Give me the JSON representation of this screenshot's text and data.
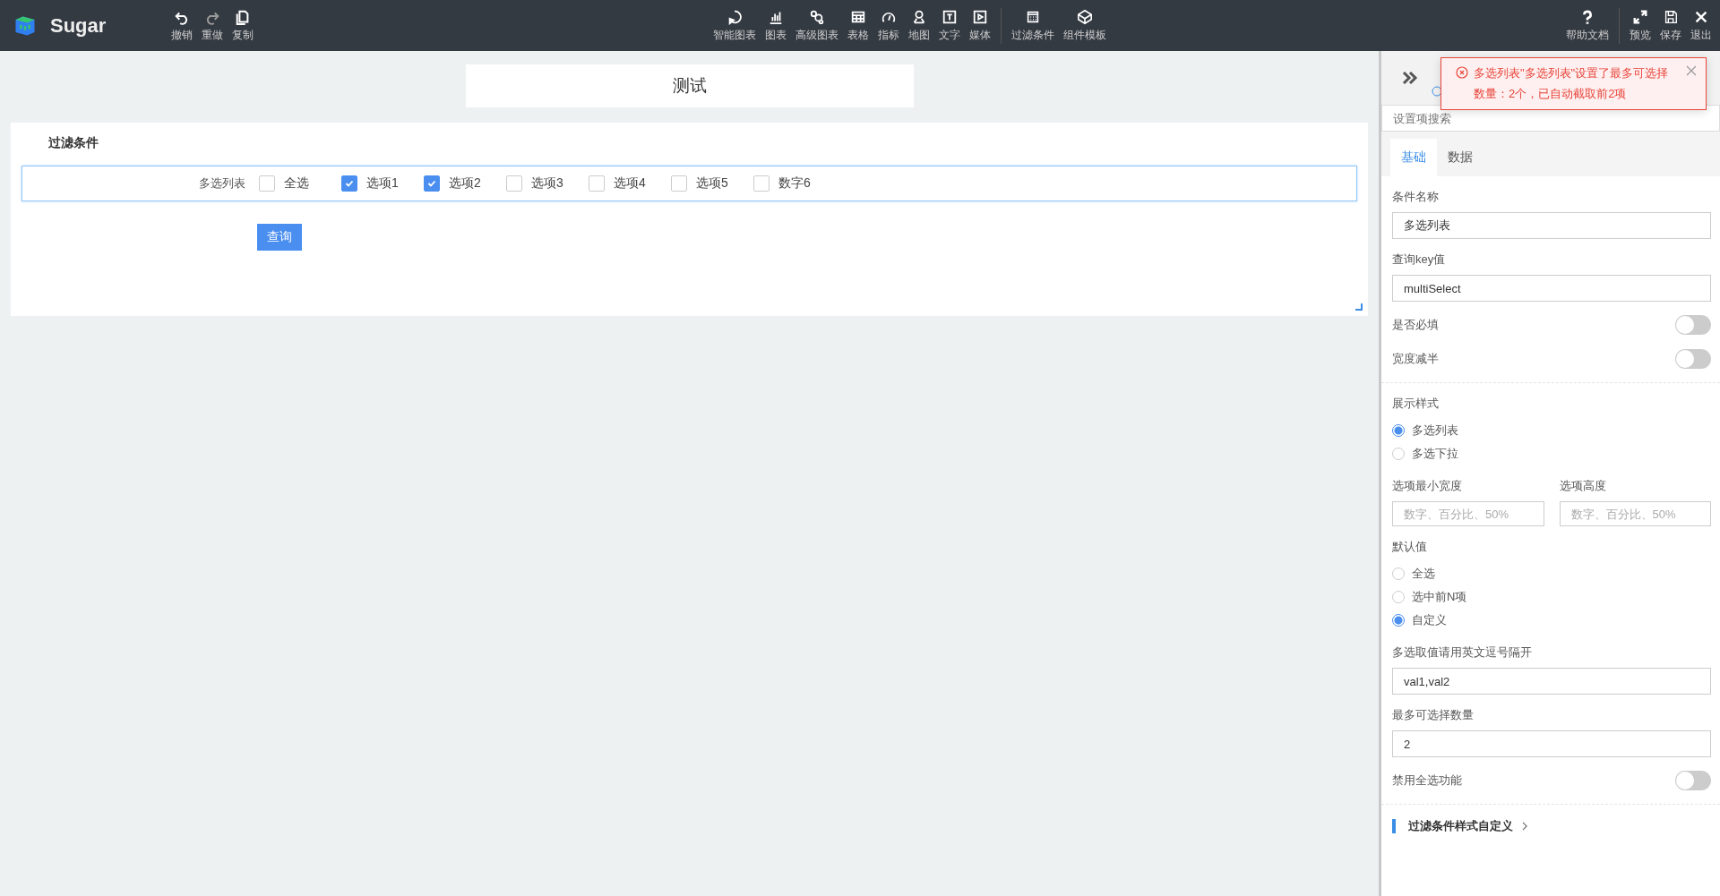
{
  "app": {
    "name": "Sugar"
  },
  "toolbar_left": [
    {
      "label": "撤销",
      "disabled": false
    },
    {
      "label": "重做",
      "disabled": true
    },
    {
      "label": "复制",
      "disabled": false
    }
  ],
  "toolbar_center": [
    {
      "label": "智能图表"
    },
    {
      "label": "图表"
    },
    {
      "label": "高级图表"
    },
    {
      "label": "表格"
    },
    {
      "label": "指标"
    },
    {
      "label": "地图"
    },
    {
      "label": "文字"
    },
    {
      "label": "媒体"
    }
  ],
  "toolbar_center_extra": [
    {
      "label": "过滤条件"
    },
    {
      "label": "组件模板"
    }
  ],
  "toolbar_right_help": {
    "label": "帮助文档"
  },
  "toolbar_right": [
    {
      "label": "预览"
    },
    {
      "label": "保存"
    },
    {
      "label": "退出"
    }
  ],
  "canvas": {
    "title": "测试",
    "filter_card": {
      "title": "过滤条件",
      "field_label": "多选列表",
      "options": [
        {
          "label": "全选",
          "checked": false
        },
        {
          "label": "选项1",
          "checked": true
        },
        {
          "label": "选项2",
          "checked": true
        },
        {
          "label": "选项3",
          "checked": false
        },
        {
          "label": "选项4",
          "checked": false
        },
        {
          "label": "选项5",
          "checked": false
        },
        {
          "label": "数字6",
          "checked": false
        }
      ],
      "query_button": "查询"
    }
  },
  "panel": {
    "toast": "多选列表\"多选列表\"设置了最多可选择数量：2个，已自动截取前2项",
    "search_placeholder": "设置项搜索",
    "tabs": [
      {
        "label": "基础",
        "selected": true
      },
      {
        "label": "数据",
        "selected": false
      }
    ],
    "groups": [
      {
        "items": [
          {
            "kind": "field",
            "label": "条件名称",
            "value": "多选列表"
          },
          {
            "kind": "field",
            "label": "查询key值",
            "value": "multiSelect"
          },
          {
            "kind": "toggle",
            "label": "是否必填",
            "on": false
          },
          {
            "kind": "toggle",
            "label": "宽度减半",
            "on": false
          }
        ]
      },
      {
        "items": [
          {
            "kind": "radio",
            "label": "展示样式",
            "options": [
              {
                "label": "多选列表",
                "selected": true
              },
              {
                "label": "多选下拉",
                "selected": false
              }
            ]
          },
          {
            "kind": "pair",
            "fields": [
              {
                "label": "选项最小宽度",
                "placeholder": "数字、百分比、50%"
              },
              {
                "label": "选项高度",
                "placeholder": "数字、百分比、50%"
              }
            ]
          },
          {
            "kind": "radio",
            "label": "默认值",
            "options": [
              {
                "label": "全选",
                "selected": false
              },
              {
                "label": "选中前N项",
                "selected": false
              },
              {
                "label": "自定义",
                "selected": true
              }
            ]
          },
          {
            "kind": "field",
            "label": "多选取值请用英文逗号隔开",
            "value": "val1,val2"
          },
          {
            "kind": "field",
            "label": "最多可选择数量",
            "value": "2"
          },
          {
            "kind": "toggle",
            "label": "禁用全选功能",
            "on": false
          }
        ]
      }
    ],
    "section_link": "过滤条件样式自定义"
  }
}
